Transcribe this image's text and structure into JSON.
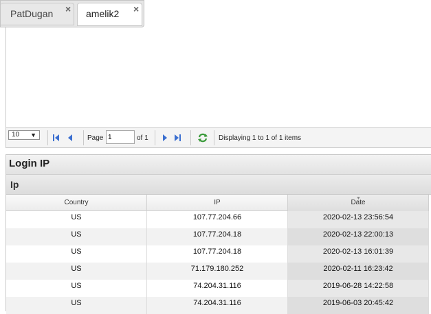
{
  "tabs": [
    {
      "label": "PatDugan",
      "close": "×",
      "active": false
    },
    {
      "label": "amelik2",
      "close": "×",
      "active": true
    }
  ],
  "pager": {
    "page_size": "10",
    "page_label": "Page",
    "page_value": "1",
    "of_label": "of 1",
    "display_message": "Displaying 1 to 1 of 1 items"
  },
  "login_panel": {
    "title": "Login IP",
    "group_header": "Ip",
    "columns": [
      "Country",
      "IP",
      "Date"
    ],
    "sorted_column": "Date",
    "rows": [
      {
        "country": "US",
        "ip": "107.77.204.66",
        "date": "2020-02-13 23:56:54"
      },
      {
        "country": "US",
        "ip": "107.77.204.18",
        "date": "2020-02-13 22:00:13"
      },
      {
        "country": "US",
        "ip": "107.77.204.18",
        "date": "2020-02-13 16:01:39"
      },
      {
        "country": "US",
        "ip": "71.179.180.252",
        "date": "2020-02-11 16:23:42"
      },
      {
        "country": "US",
        "ip": "74.204.31.116",
        "date": "2019-06-28 14:22:58"
      },
      {
        "country": "US",
        "ip": "74.204.31.116",
        "date": "2019-06-03 20:45:42"
      }
    ]
  },
  "icons": {
    "first_page": "first-page-icon",
    "prev_page": "prev-page-icon",
    "next_page": "next-page-icon",
    "last_page": "last-page-icon",
    "refresh": "refresh-icon"
  },
  "colors": {
    "nav_icon": "#3b6fd0",
    "refresh_icon": "#3a9a3a"
  }
}
